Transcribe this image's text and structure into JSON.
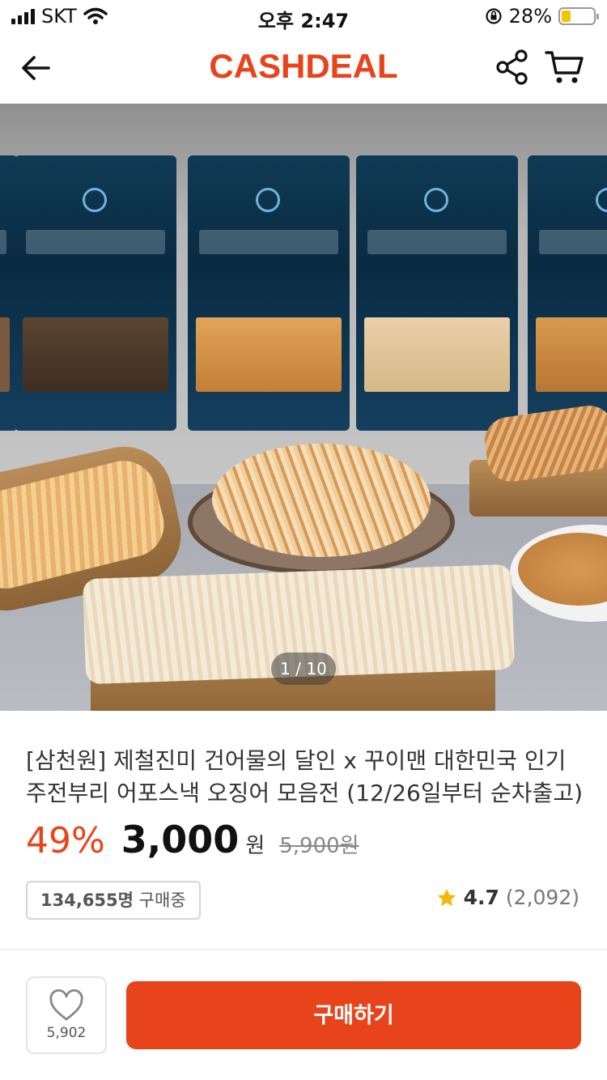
{
  "status_bar": {
    "carrier": "SKT",
    "time": "오후 2:47",
    "battery": "28%",
    "battery_level": 0.28
  },
  "header": {
    "logo": "CASHDEAL"
  },
  "gallery": {
    "counter": "1 / 10"
  },
  "product": {
    "title_line1": "[삼천원] 제철진미 건어물의 달인 x 꾸이맨 대한민국 인기",
    "title_line2": "주전부리 어포스낵 오징어 모음전 (12/26일부터 순차출고)",
    "discount": "49%",
    "price": "3,000",
    "currency": "원",
    "original_price": "5,900원",
    "buyers_count": "134,655명",
    "buyers_label": "구매중",
    "rating": "4.7",
    "review_count": "(2,092)"
  },
  "actions": {
    "like_count": "5,902",
    "buy_label": "구매하기"
  },
  "colors": {
    "accent": "#e8441b",
    "star": "#f5b800"
  }
}
